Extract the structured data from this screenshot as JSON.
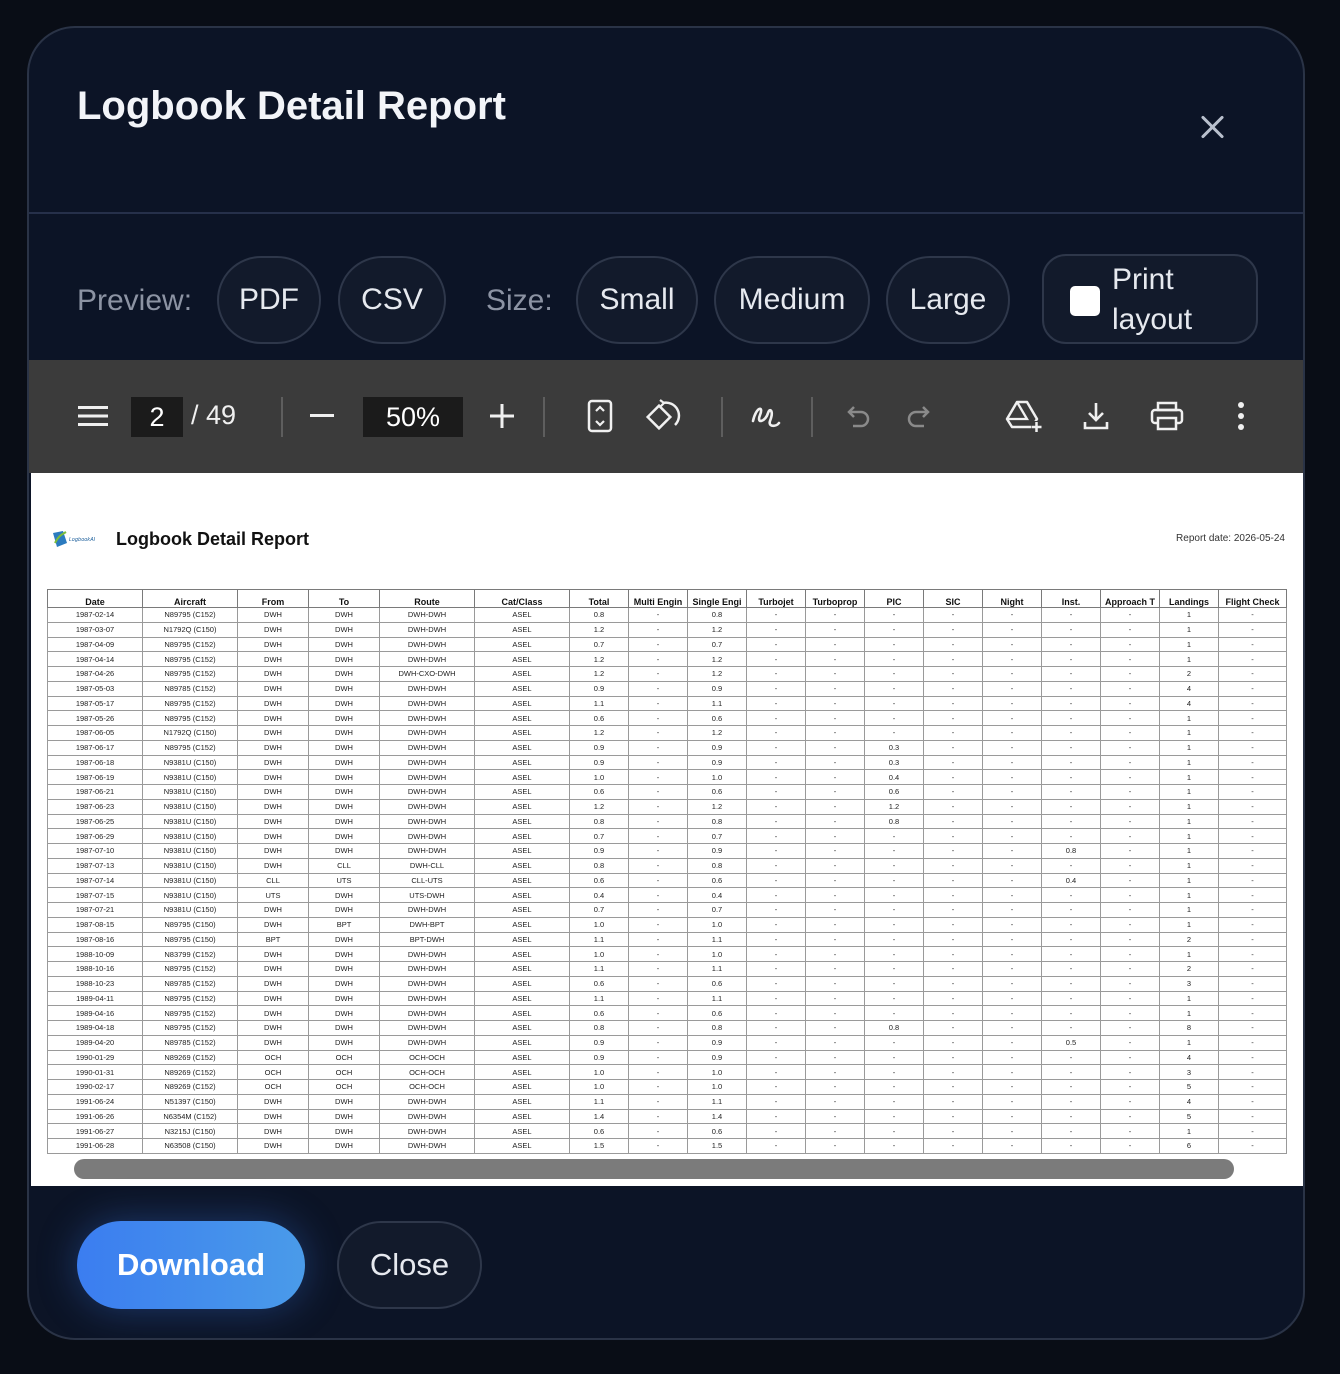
{
  "modal": {
    "title": "Logbook Detail Report"
  },
  "options": {
    "preview_label": "Preview:",
    "preview_formats": [
      "PDF",
      "CSV"
    ],
    "size_label": "Size:",
    "sizes": [
      "Small",
      "Medium",
      "Large"
    ],
    "print_layout_label": "Print layout",
    "print_layout_checked": false
  },
  "pdf_toolbar": {
    "current_page": "2",
    "total_pages": "/ 49",
    "zoom": "50%"
  },
  "report": {
    "logo_text": "LogbookAI",
    "title": "Logbook Detail Report",
    "date": "Report date: 2026-05-24",
    "columns": [
      "Date",
      "Aircraft",
      "From",
      "To",
      "Route",
      "Cat/Class",
      "Total",
      "Multi Engin",
      "Single Engi",
      "Turbojet",
      "Turboprop",
      "PIC",
      "SIC",
      "Night",
      "Inst.",
      "Approach T",
      "Landings",
      "Flight Check"
    ],
    "rows": [
      [
        "1987-02-14",
        "N89795 (C152)",
        "DWH",
        "DWH",
        "DWH-DWH",
        "ASEL",
        "0.8",
        "-",
        "0.8",
        "-",
        "-",
        "-",
        "-",
        "-",
        "-",
        "-",
        "1",
        "-"
      ],
      [
        "1987-03-07",
        "N1792Q (C150)",
        "DWH",
        "DWH",
        "DWH-DWH",
        "ASEL",
        "1.2",
        "-",
        "1.2",
        "-",
        "-",
        "-",
        "-",
        "-",
        "-",
        "-",
        "1",
        "-"
      ],
      [
        "1987-04-09",
        "N89795 (C152)",
        "DWH",
        "DWH",
        "DWH-DWH",
        "ASEL",
        "0.7",
        "-",
        "0.7",
        "-",
        "-",
        "-",
        "-",
        "-",
        "-",
        "-",
        "1",
        "-"
      ],
      [
        "1987-04-14",
        "N89795 (C152)",
        "DWH",
        "DWH",
        "DWH-DWH",
        "ASEL",
        "1.2",
        "-",
        "1.2",
        "-",
        "-",
        "-",
        "-",
        "-",
        "-",
        "-",
        "1",
        "-"
      ],
      [
        "1987-04-26",
        "N89795 (C152)",
        "DWH",
        "DWH",
        "DWH-CXO-DWH",
        "ASEL",
        "1.2",
        "-",
        "1.2",
        "-",
        "-",
        "-",
        "-",
        "-",
        "-",
        "-",
        "2",
        "-"
      ],
      [
        "1987-05-03",
        "N89785 (C152)",
        "DWH",
        "DWH",
        "DWH-DWH",
        "ASEL",
        "0.9",
        "-",
        "0.9",
        "-",
        "-",
        "-",
        "-",
        "-",
        "-",
        "-",
        "4",
        "-"
      ],
      [
        "1987-05-17",
        "N89795 (C152)",
        "DWH",
        "DWH",
        "DWH-DWH",
        "ASEL",
        "1.1",
        "-",
        "1.1",
        "-",
        "-",
        "-",
        "-",
        "-",
        "-",
        "-",
        "4",
        "-"
      ],
      [
        "1987-05-26",
        "N89795 (C152)",
        "DWH",
        "DWH",
        "DWH-DWH",
        "ASEL",
        "0.6",
        "-",
        "0.6",
        "-",
        "-",
        "-",
        "-",
        "-",
        "-",
        "-",
        "1",
        "-"
      ],
      [
        "1987-06-05",
        "N1792Q (C150)",
        "DWH",
        "DWH",
        "DWH-DWH",
        "ASEL",
        "1.2",
        "-",
        "1.2",
        "-",
        "-",
        "-",
        "-",
        "-",
        "-",
        "-",
        "1",
        "-"
      ],
      [
        "1987-06-17",
        "N89795 (C152)",
        "DWH",
        "DWH",
        "DWH-DWH",
        "ASEL",
        "0.9",
        "-",
        "0.9",
        "-",
        "-",
        "0.3",
        "-",
        "-",
        "-",
        "-",
        "1",
        "-"
      ],
      [
        "1987-06-18",
        "N9381U (C150)",
        "DWH",
        "DWH",
        "DWH-DWH",
        "ASEL",
        "0.9",
        "-",
        "0.9",
        "-",
        "-",
        "0.3",
        "-",
        "-",
        "-",
        "-",
        "1",
        "-"
      ],
      [
        "1987-06-19",
        "N9381U (C150)",
        "DWH",
        "DWH",
        "DWH-DWH",
        "ASEL",
        "1.0",
        "-",
        "1.0",
        "-",
        "-",
        "0.4",
        "-",
        "-",
        "-",
        "-",
        "1",
        "-"
      ],
      [
        "1987-06-21",
        "N9381U (C150)",
        "DWH",
        "DWH",
        "DWH-DWH",
        "ASEL",
        "0.6",
        "-",
        "0.6",
        "-",
        "-",
        "0.6",
        "-",
        "-",
        "-",
        "-",
        "1",
        "-"
      ],
      [
        "1987-06-23",
        "N9381U (C150)",
        "DWH",
        "DWH",
        "DWH-DWH",
        "ASEL",
        "1.2",
        "-",
        "1.2",
        "-",
        "-",
        "1.2",
        "-",
        "-",
        "-",
        "-",
        "1",
        "-"
      ],
      [
        "1987-06-25",
        "N9381U (C150)",
        "DWH",
        "DWH",
        "DWH-DWH",
        "ASEL",
        "0.8",
        "-",
        "0.8",
        "-",
        "-",
        "0.8",
        "-",
        "-",
        "-",
        "-",
        "1",
        "-"
      ],
      [
        "1987-06-29",
        "N9381U (C150)",
        "DWH",
        "DWH",
        "DWH-DWH",
        "ASEL",
        "0.7",
        "-",
        "0.7",
        "-",
        "-",
        "-",
        "-",
        "-",
        "-",
        "-",
        "1",
        "-"
      ],
      [
        "1987-07-10",
        "N9381U (C150)",
        "DWH",
        "DWH",
        "DWH-DWH",
        "ASEL",
        "0.9",
        "-",
        "0.9",
        "-",
        "-",
        "-",
        "-",
        "-",
        "0.8",
        "-",
        "1",
        "-"
      ],
      [
        "1987-07-13",
        "N9381U (C150)",
        "DWH",
        "CLL",
        "DWH-CLL",
        "ASEL",
        "0.8",
        "-",
        "0.8",
        "-",
        "-",
        "-",
        "-",
        "-",
        "-",
        "-",
        "1",
        "-"
      ],
      [
        "1987-07-14",
        "N9381U (C150)",
        "CLL",
        "UTS",
        "CLL-UTS",
        "ASEL",
        "0.6",
        "-",
        "0.6",
        "-",
        "-",
        "-",
        "-",
        "-",
        "0.4",
        "-",
        "1",
        "-"
      ],
      [
        "1987-07-15",
        "N9381U (C150)",
        "UTS",
        "DWH",
        "UTS-DWH",
        "ASEL",
        "0.4",
        "-",
        "0.4",
        "-",
        "-",
        "-",
        "-",
        "-",
        "-",
        "-",
        "1",
        "-"
      ],
      [
        "1987-07-21",
        "N9381U (C150)",
        "DWH",
        "DWH",
        "DWH-DWH",
        "ASEL",
        "0.7",
        "-",
        "0.7",
        "-",
        "-",
        "-",
        "-",
        "-",
        "-",
        "-",
        "1",
        "-"
      ],
      [
        "1987-08-15",
        "N89795 (C150)",
        "DWH",
        "BPT",
        "DWH-BPT",
        "ASEL",
        "1.0",
        "-",
        "1.0",
        "-",
        "-",
        "-",
        "-",
        "-",
        "-",
        "-",
        "1",
        "-"
      ],
      [
        "1987-08-16",
        "N89795 (C150)",
        "BPT",
        "DWH",
        "BPT-DWH",
        "ASEL",
        "1.1",
        "-",
        "1.1",
        "-",
        "-",
        "-",
        "-",
        "-",
        "-",
        "-",
        "2",
        "-"
      ],
      [
        "1988-10-09",
        "N83799 (C152)",
        "DWH",
        "DWH",
        "DWH-DWH",
        "ASEL",
        "1.0",
        "-",
        "1.0",
        "-",
        "-",
        "-",
        "-",
        "-",
        "-",
        "-",
        "1",
        "-"
      ],
      [
        "1988-10-16",
        "N89795 (C152)",
        "DWH",
        "DWH",
        "DWH-DWH",
        "ASEL",
        "1.1",
        "-",
        "1.1",
        "-",
        "-",
        "-",
        "-",
        "-",
        "-",
        "-",
        "2",
        "-"
      ],
      [
        "1988-10-23",
        "N89785 (C152)",
        "DWH",
        "DWH",
        "DWH-DWH",
        "ASEL",
        "0.6",
        "-",
        "0.6",
        "-",
        "-",
        "-",
        "-",
        "-",
        "-",
        "-",
        "3",
        "-"
      ],
      [
        "1989-04-11",
        "N89795 (C152)",
        "DWH",
        "DWH",
        "DWH-DWH",
        "ASEL",
        "1.1",
        "-",
        "1.1",
        "-",
        "-",
        "-",
        "-",
        "-",
        "-",
        "-",
        "1",
        "-"
      ],
      [
        "1989-04-16",
        "N89795 (C152)",
        "DWH",
        "DWH",
        "DWH-DWH",
        "ASEL",
        "0.6",
        "-",
        "0.6",
        "-",
        "-",
        "-",
        "-",
        "-",
        "-",
        "-",
        "1",
        "-"
      ],
      [
        "1989-04-18",
        "N89795 (C152)",
        "DWH",
        "DWH",
        "DWH-DWH",
        "ASEL",
        "0.8",
        "-",
        "0.8",
        "-",
        "-",
        "0.8",
        "-",
        "-",
        "-",
        "-",
        "8",
        "-"
      ],
      [
        "1989-04-20",
        "N89785 (C152)",
        "DWH",
        "DWH",
        "DWH-DWH",
        "ASEL",
        "0.9",
        "-",
        "0.9",
        "-",
        "-",
        "-",
        "-",
        "-",
        "0.5",
        "-",
        "1",
        "-"
      ],
      [
        "1990-01-29",
        "N89269 (C152)",
        "OCH",
        "OCH",
        "OCH-OCH",
        "ASEL",
        "0.9",
        "-",
        "0.9",
        "-",
        "-",
        "-",
        "-",
        "-",
        "-",
        "-",
        "4",
        "-"
      ],
      [
        "1990-01-31",
        "N89269 (C152)",
        "OCH",
        "OCH",
        "OCH-OCH",
        "ASEL",
        "1.0",
        "-",
        "1.0",
        "-",
        "-",
        "-",
        "-",
        "-",
        "-",
        "-",
        "3",
        "-"
      ],
      [
        "1990-02-17",
        "N89269 (C152)",
        "OCH",
        "OCH",
        "OCH-OCH",
        "ASEL",
        "1.0",
        "-",
        "1.0",
        "-",
        "-",
        "-",
        "-",
        "-",
        "-",
        "-",
        "5",
        "-"
      ],
      [
        "1991-06-24",
        "N51397 (C150)",
        "DWH",
        "DWH",
        "DWH-DWH",
        "ASEL",
        "1.1",
        "-",
        "1.1",
        "-",
        "-",
        "-",
        "-",
        "-",
        "-",
        "-",
        "4",
        "-"
      ],
      [
        "1991-06-26",
        "N6354M (C152)",
        "DWH",
        "DWH",
        "DWH-DWH",
        "ASEL",
        "1.4",
        "-",
        "1.4",
        "-",
        "-",
        "-",
        "-",
        "-",
        "-",
        "-",
        "5",
        "-"
      ],
      [
        "1991-06-27",
        "N3215J (C150)",
        "DWH",
        "DWH",
        "DWH-DWH",
        "ASEL",
        "0.6",
        "-",
        "0.6",
        "-",
        "-",
        "-",
        "-",
        "-",
        "-",
        "-",
        "1",
        "-"
      ],
      [
        "1991-06-28",
        "N63508 (C150)",
        "DWH",
        "DWH",
        "DWH-DWH",
        "ASEL",
        "1.5",
        "-",
        "1.5",
        "-",
        "-",
        "-",
        "-",
        "-",
        "-",
        "-",
        "6",
        "-"
      ]
    ]
  },
  "footer": {
    "download_label": "Download",
    "close_label": "Close"
  }
}
